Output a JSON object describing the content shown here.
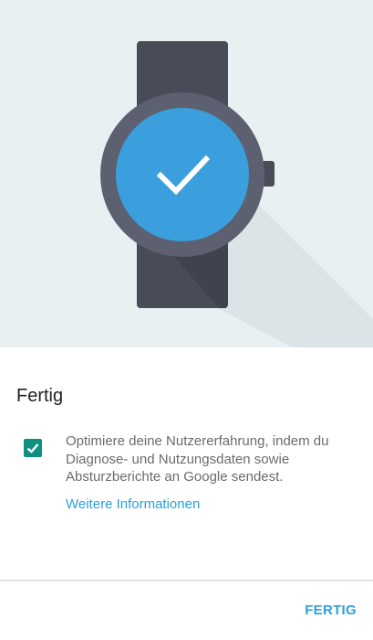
{
  "screen": {
    "title": "Fertig",
    "consent": {
      "checked": true,
      "text": "Optimiere deine Nutzererfahrung, indem du Diagnose- und Nutzungsdaten sowie Absturzberichte an Google sendest.",
      "link_label": "Weitere Informationen"
    },
    "actions": {
      "done_label": "FERTIG"
    }
  },
  "illustration": {
    "icon": "watch-check-icon"
  },
  "colors": {
    "hero_background": "#e8f0f1",
    "watch_band": "#474c57",
    "watch_bezel": "#5c6070",
    "watch_face": "#3a9fdc",
    "checkbox": "#0e8f80",
    "accent": "#2d9fd8"
  }
}
